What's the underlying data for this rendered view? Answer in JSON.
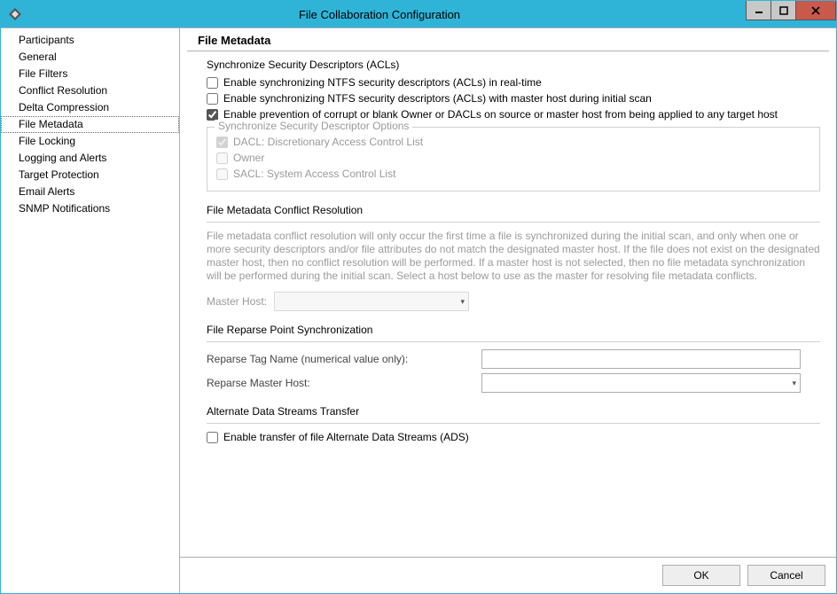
{
  "window": {
    "title": "File Collaboration Configuration"
  },
  "sidebar": {
    "items": [
      {
        "label": "Participants",
        "selected": false
      },
      {
        "label": "General",
        "selected": false
      },
      {
        "label": "File Filters",
        "selected": false
      },
      {
        "label": "Conflict Resolution",
        "selected": false
      },
      {
        "label": "Delta Compression",
        "selected": false
      },
      {
        "label": "File Metadata",
        "selected": true
      },
      {
        "label": "File Locking",
        "selected": false
      },
      {
        "label": "Logging and Alerts",
        "selected": false
      },
      {
        "label": "Target Protection",
        "selected": false
      },
      {
        "label": "Email Alerts",
        "selected": false
      },
      {
        "label": "SNMP Notifications",
        "selected": false
      }
    ]
  },
  "page": {
    "heading": "File Metadata",
    "acl": {
      "title": "Synchronize Security Descriptors (ACLs)",
      "opt_realtime": "Enable synchronizing NTFS security descriptors (ACLs) in real-time",
      "opt_initial": "Enable synchronizing NTFS security descriptors (ACLs) with master host during initial scan",
      "opt_prevent": "Enable prevention of corrupt or blank Owner or DACLs on source or master host from being applied to any target host",
      "subgroup_title": "Synchronize Security Descriptor Options",
      "dacl": "DACL: Discretionary Access Control List",
      "owner": "Owner",
      "sacl": "SACL: System Access Control List"
    },
    "conflict": {
      "title": "File Metadata Conflict Resolution",
      "help": "File metadata conflict resolution will only occur the first time a file is synchronized during the initial scan, and only when one or more security descriptors and/or file attributes do not match the designated master host. If the file does not exist on the designated master host, then no conflict resolution will be performed. If a master host is not selected, then no file metadata synchronization will be performed during the initial scan. Select a host below to use as the master for resolving file metadata conflicts.",
      "master_label": "Master Host:"
    },
    "reparse": {
      "title": "File Reparse Point Synchronization",
      "tag_label": "Reparse Tag Name (numerical value only):",
      "host_label": "Reparse Master Host:"
    },
    "ads": {
      "title": "Alternate Data Streams Transfer",
      "opt": "Enable transfer of file Alternate Data Streams (ADS)"
    }
  },
  "footer": {
    "ok": "OK",
    "cancel": "Cancel"
  }
}
